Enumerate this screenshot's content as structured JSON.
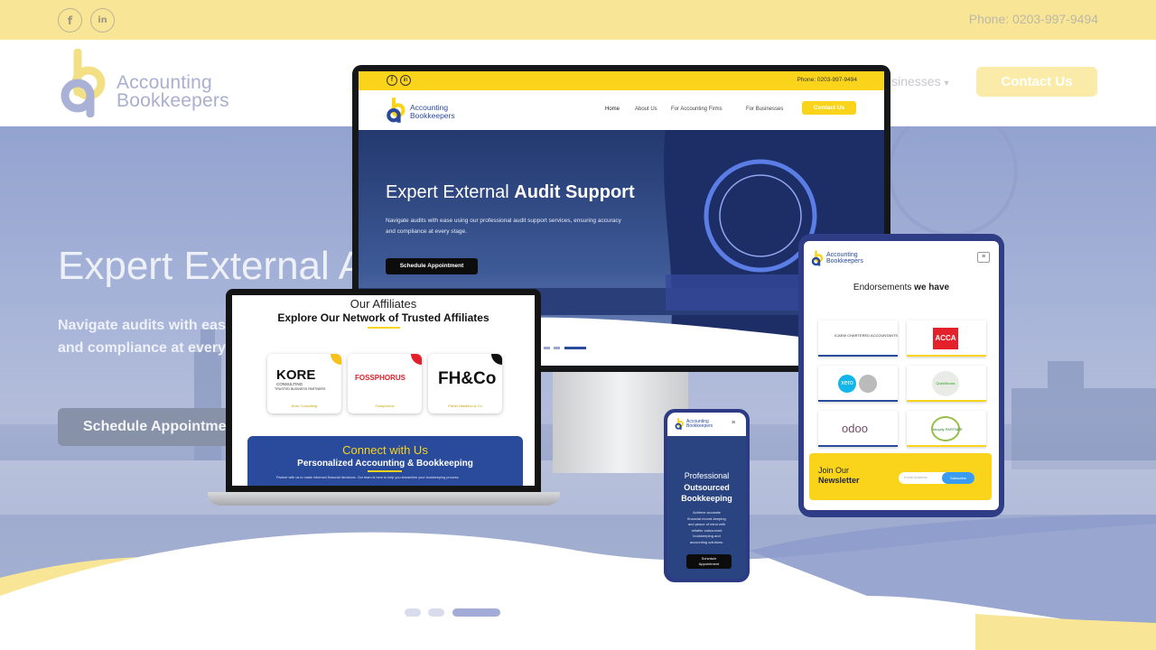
{
  "topbar": {
    "facebook": "f",
    "linkedin": "in",
    "phone": "Phone: 0203-997-9494"
  },
  "nav": {
    "logo_line1": "Accounting",
    "logo_line2": "Bookkeepers",
    "businesses": "isinesses",
    "contact": "Contact Us"
  },
  "hero": {
    "title": "Expert External A",
    "subtitle_line1": "Navigate audits with ease",
    "subtitle_line2": "and compliance at every s",
    "button": "Schedule Appointmer"
  },
  "monitor": {
    "phone": "Phone: 0203-997-9494",
    "logo_line1": "Accounting",
    "logo_line2": "Bookkeepers",
    "menu": [
      "Home",
      "About Us",
      "For Accounting Firms",
      "For Businesses"
    ],
    "contact": "Contact Us",
    "title_a": "Expert External ",
    "title_b": "Audit Support",
    "text_line1": "Navigate audits with ease using our professional audit support services, ensuring accuracy",
    "text_line2": "and compliance at every stage.",
    "button": "Schedule Appointment"
  },
  "laptop": {
    "heading1": "Our Affiliates",
    "heading2": "Explore Our Network of Trusted Affiliates",
    "affiliates": [
      {
        "logo": "KORE",
        "tag": "CONSULTING",
        "sub": "TRUSTED BUSINESS PARTNERS",
        "caption": "Kore Consulting",
        "accent": "#f6c11a"
      },
      {
        "logo": "FOSSPHORUS",
        "caption": "Fossphorus",
        "accent": "#e4202b"
      },
      {
        "logo": "FH&Co",
        "caption": "Fishel Hamilton & Co",
        "accent": "#111111"
      }
    ],
    "connect": "Connect with Us",
    "connect_sub": "Personalized Accounting & Bookkeeping",
    "connect_text": "Partner with us to make informed financial decisions. Our team is here to help you streamline your bookkeeping process."
  },
  "tablet": {
    "logo_line1": "Accounting",
    "logo_line2": "Bookkeepers",
    "heading_a": "Endorsements ",
    "heading_b": "we have",
    "endorsements": [
      "ICAEW CHARTERED ACCOUNTANTS",
      "ACCA",
      "xero",
      "QuickBooks",
      "odoo",
      "shopify PARTNER"
    ],
    "newsletter_a": "Join Our",
    "newsletter_b": "Newsletter",
    "email_placeholder": "Email Address",
    "subscribe": "Subscribe"
  },
  "phone": {
    "logo_line1": "Accounting",
    "logo_line2": "Bookkeepers",
    "title_line1": "Professional",
    "title_line2": "Outsourced",
    "title_line3": "Bookkeeping",
    "text": [
      "Achieve accurate",
      "financial record-keeping",
      "and peace of mind with",
      "reliable outsourced",
      "bookkeeping and",
      "accounting solutions."
    ],
    "button_line1": "Schedule",
    "button_line2": "Appointment"
  },
  "slider": {
    "active_index": 3,
    "count": 3
  },
  "colors": {
    "topbar": "#f8e596",
    "brand_yellow": "#f9d41a",
    "brand_blue": "#2a4b9b",
    "hero": "#9faccf"
  }
}
